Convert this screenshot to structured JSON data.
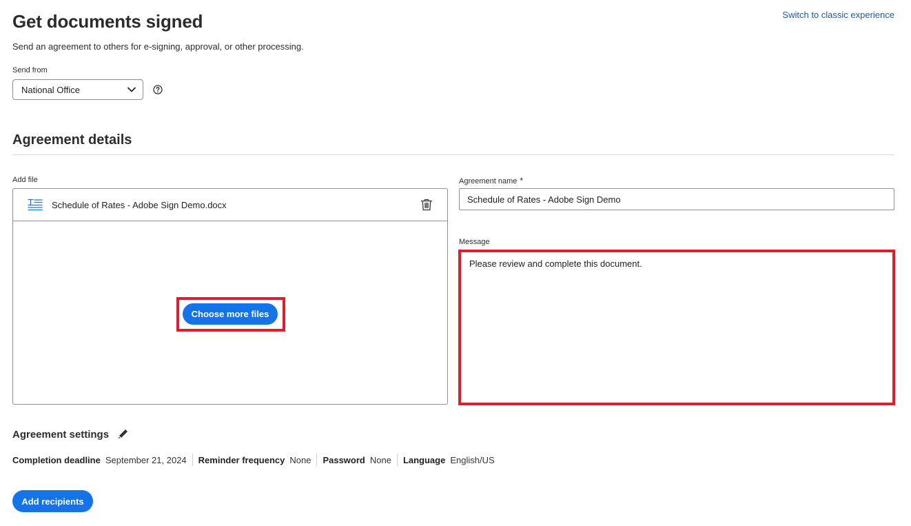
{
  "header": {
    "title": "Get documents signed",
    "subtitle": "Send an agreement to others for e-signing, approval, or other processing.",
    "classic_link": "Switch to classic experience"
  },
  "send_from": {
    "label": "Send from",
    "value": "National Office",
    "icons": [
      "chevron-down-icon",
      "help-icon"
    ]
  },
  "agreement_details": {
    "title": "Agreement details",
    "add_file_label": "Add file",
    "file": {
      "name": "Schedule of Rates - Adobe Sign Demo.docx",
      "icon": "document-icon",
      "delete_icon": "trash-icon"
    },
    "choose_more_label": "Choose more files",
    "agreement_name_label": "Agreement name",
    "required_marker": "*",
    "agreement_name_value": "Schedule of Rates - Adobe Sign Demo",
    "message_label": "Message",
    "message_value": "Please review and complete this document."
  },
  "settings": {
    "title": "Agreement settings",
    "edit_icon": "pencil-icon",
    "items": [
      {
        "label": "Completion deadline",
        "value": "September 21, 2024"
      },
      {
        "label": "Reminder frequency",
        "value": "None"
      },
      {
        "label": "Password",
        "value": "None"
      },
      {
        "label": "Language",
        "value": "English/US"
      }
    ]
  },
  "footer": {
    "add_recipients_label": "Add recipients"
  },
  "colors": {
    "accent": "#1473e6",
    "highlight": "#e01e2b",
    "link": "#1a5aa8"
  }
}
